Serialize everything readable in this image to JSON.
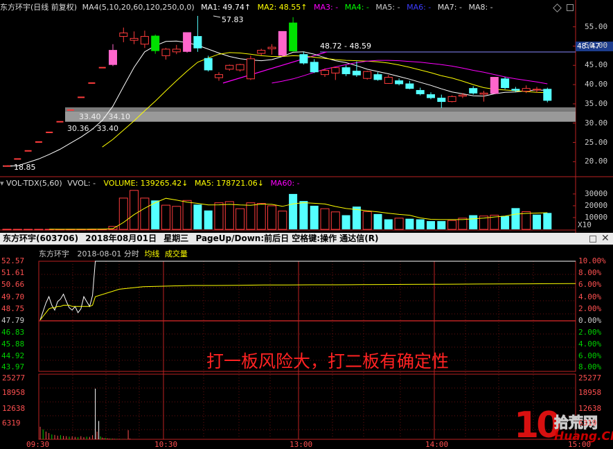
{
  "kline_header": {
    "stock": "东方环宇(日线 前复权)",
    "ma_setting": "MA4(5,10,20,60,120,250,0,0)",
    "ma1": "MA1: 49.74↑",
    "ma2": "MA2: 48.55↑",
    "ma3": "MA3: -",
    "ma4": "MA4: -",
    "ma5": "MA5: -",
    "ma6": "MA6: -",
    "ma7": "MA7: -",
    "ma8": "MA8: -"
  },
  "kline_annotations": {
    "high_label": "57.83",
    "low_label": "18.85",
    "mid_label": "48.72 - 48.59",
    "band1_label": "33.40 - 34.10",
    "band2_label": "30.36 - 33.40",
    "last_price": "48.47"
  },
  "kline_yaxis": [
    "55.00",
    "50.00",
    "45.00",
    "40.00",
    "35.00",
    "30.00",
    "25.00",
    "20.00"
  ],
  "vol_header": {
    "name": "VOL-TDX(5,60)",
    "vvol": "VVOL: -",
    "volume": "VOLUME: 139265.42↓",
    "ma5": "MA5: 178721.06↓",
    "ma60": "MA60: -"
  },
  "vol_yaxis": [
    "30000",
    "20000",
    "10000"
  ],
  "vol_unit": "X10",
  "intraday_bar": {
    "title": "东方环宇(603706)",
    "date": "2018年08月01日",
    "weekday": "星期三",
    "hint": "PageUp/Down:前后日 空格键:操作 通达信(R)"
  },
  "intraday_header": {
    "name": "东方环宇",
    "datetime": "2018-08-01 分时",
    "avg": "均线",
    "vol": "成交量"
  },
  "intraday_left_axis": [
    "52.57",
    "51.61",
    "50.66",
    "49.70",
    "48.75",
    "47.79",
    "46.83",
    "45.88",
    "44.92",
    "43.97"
  ],
  "intraday_right_axis": [
    "10.00%",
    "8.00%",
    "6.00%",
    "4.00%",
    "2.00%",
    "0.00%",
    "2.00%",
    "4.00%",
    "6.00%",
    "8.00%"
  ],
  "intraday_vol_axis": [
    "25277",
    "18958",
    "12638",
    "6319"
  ],
  "time_axis": [
    "09:30",
    "10:30",
    "13:00",
    "14:00",
    "15:00"
  ],
  "caption": "打一板风险大，打二板有确定性",
  "watermark": {
    "logo": "10",
    "cn": "拾荒网",
    "en": "Huang.CN"
  },
  "colors": {
    "up": "#ff3c3c",
    "down": "#54ffff",
    "limit_up": "#ff66cc",
    "green_bar": "#00e000",
    "ma1": "#ffffff",
    "ma2": "#ffff00",
    "ma3": "#ff00ff",
    "ma4": "#00ff00",
    "ma6": "#3333ff"
  },
  "chart_data": [
    {
      "type": "candlestick",
      "title": "东方环宇(日线 前复权)",
      "yaxis_ticks": [
        55,
        50,
        45,
        40,
        35,
        30,
        25,
        20
      ],
      "ylim": [
        17,
        58
      ],
      "candles": [
        {
          "o": 18.85,
          "h": 18.85,
          "c": 18.85,
          "l": 18.85,
          "t": "flat"
        },
        {
          "o": 20.7,
          "h": 20.7,
          "c": 20.7,
          "l": 20.7,
          "t": "flat"
        },
        {
          "o": 22.8,
          "h": 22.8,
          "c": 22.8,
          "l": 22.8,
          "t": "flat"
        },
        {
          "o": 25.1,
          "h": 25.1,
          "c": 25.1,
          "l": 25.1,
          "t": "flat"
        },
        {
          "o": 27.6,
          "h": 27.6,
          "c": 27.6,
          "l": 27.6,
          "t": "flat"
        },
        {
          "o": 30.36,
          "h": 30.36,
          "c": 30.36,
          "l": 30.36,
          "t": "flat"
        },
        {
          "o": 33.4,
          "h": 33.4,
          "c": 33.4,
          "l": 33.4,
          "t": "flat"
        },
        {
          "o": 36.7,
          "h": 36.7,
          "c": 36.7,
          "l": 36.7,
          "t": "flat"
        },
        {
          "o": 40.4,
          "h": 40.4,
          "c": 40.4,
          "l": 40.4,
          "t": "flat"
        },
        {
          "o": 44.4,
          "h": 44.4,
          "c": 44.4,
          "l": 44.4,
          "t": "flat"
        },
        {
          "o": 45.2,
          "h": 50.5,
          "c": 48.9,
          "l": 44.8,
          "t": "limit"
        },
        {
          "o": 52.5,
          "h": 54.8,
          "c": 53.4,
          "l": 51.0,
          "t": "up"
        },
        {
          "o": 52.0,
          "h": 53.8,
          "c": 51.5,
          "l": 50.5,
          "t": "up"
        },
        {
          "o": 50.5,
          "h": 54.0,
          "c": 52.5,
          "l": 49.5,
          "t": "up"
        },
        {
          "o": 52.6,
          "h": 53.0,
          "c": 48.8,
          "l": 48.0,
          "t": "green"
        },
        {
          "o": 47.5,
          "h": 49.5,
          "c": 49.2,
          "l": 46.5,
          "t": "up"
        },
        {
          "o": 48.5,
          "h": 50.3,
          "c": 49.2,
          "l": 47.9,
          "t": "up"
        },
        {
          "o": 48.6,
          "h": 53.5,
          "c": 53.5,
          "l": 48.3,
          "t": "limit"
        },
        {
          "o": 52.5,
          "h": 57.83,
          "c": 49.5,
          "l": 48.5,
          "t": "down"
        },
        {
          "o": 46.8,
          "h": 47.5,
          "c": 43.8,
          "l": 43.4,
          "t": "down"
        },
        {
          "o": 41.8,
          "h": 43.2,
          "c": 42.6,
          "l": 41.0,
          "t": "up"
        },
        {
          "o": 44.0,
          "h": 45.2,
          "c": 45.0,
          "l": 43.6,
          "t": "up"
        },
        {
          "o": 43.8,
          "h": 45.4,
          "c": 45.2,
          "l": 43.4,
          "t": "up"
        },
        {
          "o": 41.5,
          "h": 47.5,
          "c": 46.7,
          "l": 41.2,
          "t": "up"
        },
        {
          "o": 48.1,
          "h": 49.3,
          "c": 48.9,
          "l": 47.6,
          "t": "up"
        },
        {
          "o": 49.7,
          "h": 50.5,
          "c": 49.3,
          "l": 47.8,
          "t": "up"
        },
        {
          "o": 47.6,
          "h": 53.8,
          "c": 53.8,
          "l": 47.2,
          "t": "limit"
        },
        {
          "o": 56.0,
          "h": 57.5,
          "c": 48.72,
          "l": 48.59,
          "t": "green"
        },
        {
          "o": 47.8,
          "h": 48.5,
          "c": 45.6,
          "l": 45.2,
          "t": "down"
        },
        {
          "o": 45.8,
          "h": 46.6,
          "c": 43.3,
          "l": 43.0,
          "t": "down"
        },
        {
          "o": 42.6,
          "h": 44.2,
          "c": 43.7,
          "l": 42.0,
          "t": "up"
        },
        {
          "o": 43.0,
          "h": 44.6,
          "c": 44.4,
          "l": 41.2,
          "t": "up"
        },
        {
          "o": 44.4,
          "h": 45.0,
          "c": 42.8,
          "l": 42.2,
          "t": "down"
        },
        {
          "o": 42.5,
          "h": 46.0,
          "c": 43.5,
          "l": 42.0,
          "t": "down"
        },
        {
          "o": 43.4,
          "h": 43.6,
          "c": 41.6,
          "l": 41.3,
          "t": "up"
        },
        {
          "o": 42.6,
          "h": 43.2,
          "c": 41.3,
          "l": 41.0,
          "t": "down"
        },
        {
          "o": 41.9,
          "h": 42.5,
          "c": 40.3,
          "l": 40.2,
          "t": "up"
        },
        {
          "o": 41.0,
          "h": 41.6,
          "c": 40.2,
          "l": 39.8,
          "t": "down"
        },
        {
          "o": 40.2,
          "h": 41.0,
          "c": 39.0,
          "l": 38.8,
          "t": "down"
        },
        {
          "o": 38.5,
          "h": 39.2,
          "c": 37.6,
          "l": 37.2,
          "t": "down"
        },
        {
          "o": 37.4,
          "h": 38.0,
          "c": 36.6,
          "l": 36.2,
          "t": "down"
        },
        {
          "o": 36.5,
          "h": 37.4,
          "c": 35.6,
          "l": 33.9,
          "t": "down"
        },
        {
          "o": 35.6,
          "h": 37.2,
          "c": 36.9,
          "l": 35.4,
          "t": "up"
        },
        {
          "o": 37.0,
          "h": 37.8,
          "c": 37.3,
          "l": 36.5,
          "t": "up"
        },
        {
          "o": 39.0,
          "h": 39.6,
          "c": 37.8,
          "l": 37.4,
          "t": "down"
        },
        {
          "o": 37.8,
          "h": 38.4,
          "c": 37.5,
          "l": 35.6,
          "t": "up"
        },
        {
          "o": 37.7,
          "h": 41.9,
          "c": 41.9,
          "l": 37.6,
          "t": "limit"
        },
        {
          "o": 41.5,
          "h": 42.0,
          "c": 39.2,
          "l": 38.8,
          "t": "down"
        },
        {
          "o": 38.5,
          "h": 39.4,
          "c": 38.8,
          "l": 38.0,
          "t": "down"
        },
        {
          "o": 38.3,
          "h": 39.8,
          "c": 39.0,
          "l": 37.8,
          "t": "up"
        },
        {
          "o": 38.8,
          "h": 39.4,
          "c": 38.6,
          "l": 37.9,
          "t": "up"
        },
        {
          "o": 38.8,
          "h": 39.2,
          "c": 35.9,
          "l": 35.4,
          "t": "down"
        }
      ],
      "series": [
        {
          "name": "MA1",
          "values": [
            18.9,
            18.9,
            19.8,
            20.7,
            21.9,
            23.2,
            24.8,
            26.4,
            28.3,
            30.7,
            34.4,
            39.5,
            44.5,
            48.5,
            50.1,
            51.2,
            51.3,
            50.9,
            50.2,
            49.2,
            48.2,
            47.3,
            46.7,
            46.4,
            46.2,
            46.5,
            47.3,
            48.4,
            48.5,
            47.9,
            47.0,
            46.2,
            45.7,
            44.9,
            44.0,
            43.4,
            42.8,
            42.1,
            41.4,
            40.6,
            39.8,
            38.9,
            38.1,
            37.6,
            37.1,
            37.0,
            37.6,
            38.0,
            38.1,
            38.4,
            38.6,
            38.5
          ]
        },
        {
          "name": "MA2",
          "values": [
            null,
            null,
            null,
            null,
            null,
            null,
            null,
            null,
            null,
            23.8,
            25.8,
            28.2,
            30.6,
            33.2,
            35.7,
            38.4,
            41.0,
            43.5,
            45.8,
            46.9,
            47.9,
            48.3,
            48.2,
            47.9,
            47.5,
            47.3,
            47.3,
            47.5,
            47.4,
            47.1,
            46.8,
            46.5,
            46.3,
            46.2,
            46.1,
            45.9,
            45.6,
            45.1,
            44.5,
            43.8,
            43.1,
            42.3,
            41.7,
            40.9,
            40.0,
            39.2,
            38.8,
            38.6,
            38.4,
            38.2,
            38.0,
            37.9
          ]
        },
        {
          "name": "MA3",
          "values": [
            null,
            null,
            null,
            null,
            null,
            null,
            null,
            null,
            null,
            null,
            null,
            null,
            null,
            null,
            null,
            null,
            null,
            null,
            null,
            null,
            null,
            null,
            null,
            null,
            null,
            40.4,
            40.9,
            41.5,
            42.3,
            43.2,
            44.0,
            44.6,
            45.2,
            45.7,
            46.1,
            46.3,
            46.3,
            46.2,
            46.0,
            45.8,
            45.5,
            45.2,
            44.8,
            44.3,
            43.7,
            43.2,
            42.6,
            42.0,
            41.5,
            41.1,
            40.7,
            40.2
          ]
        }
      ]
    },
    {
      "type": "bar",
      "title": "VOL-TDX(5,60)",
      "unit": "X10",
      "yaxis_ticks": [
        30000,
        20000,
        10000
      ],
      "ylim": [
        0,
        37000
      ],
      "values": [
        120,
        60,
        60,
        60,
        60,
        60,
        100,
        120,
        160,
        200,
        2500,
        26500,
        33000,
        26500,
        24500,
        20500,
        19500,
        24500,
        21000,
        16000,
        22500,
        23500,
        17500,
        22500,
        22000,
        20000,
        15500,
        30000,
        24000,
        20000,
        17500,
        14800,
        12000,
        19300,
        15000,
        13000,
        8500,
        9500,
        9000,
        8500,
        7000,
        7000,
        7500,
        9500,
        12000,
        11300,
        12000,
        11300,
        18000,
        15000,
        12500,
        13900
      ],
      "colors": [
        "r",
        "r",
        "r",
        "r",
        "r",
        "r",
        "r",
        "r",
        "r",
        "r",
        "r",
        "r",
        "r",
        "r",
        "c",
        "r",
        "r",
        "r",
        "c",
        "c",
        "r",
        "r",
        "r",
        "r",
        "r",
        "r",
        "r",
        "c",
        "c",
        "c",
        "r",
        "r",
        "c",
        "c",
        "r",
        "c",
        "c",
        "r",
        "c",
        "c",
        "c",
        "c",
        "r",
        "r",
        "c",
        "r",
        "r",
        "c",
        "c",
        "r",
        "c",
        "c"
      ],
      "series": [
        {
          "name": "MA5",
          "values": [
            null,
            null,
            null,
            null,
            90,
            60,
            70,
            80,
            110,
            140,
            600,
            5900,
            12500,
            17900,
            22600,
            26300,
            24800,
            23100,
            22000,
            20700,
            20800,
            21200,
            20700,
            20400,
            21400,
            21200,
            19500,
            21600,
            22600,
            22100,
            21500,
            19400,
            17700,
            16800,
            15700,
            14800,
            13700,
            12700,
            12000,
            9700,
            8500,
            8300,
            8300,
            8300,
            8900,
            9600,
            10500,
            11200,
            12900,
            13500,
            13800,
            14100
          ]
        }
      ]
    },
    {
      "type": "line",
      "title": "东方环宇 2018-08-01 分时",
      "x": [
        "09:30",
        "10:30",
        "13:00",
        "14:00",
        "15:00"
      ],
      "y_ticks_left": [
        52.57,
        51.61,
        50.66,
        49.7,
        48.75,
        47.79,
        46.83,
        45.88,
        44.92,
        43.97
      ],
      "y_ticks_right": [
        "10.00%",
        "8.00%",
        "6.00%",
        "4.00%",
        "2.00%",
        "0.00%",
        "2.00%",
        "4.00%",
        "6.00%",
        "8.00%"
      ],
      "ylim": [
        43.5,
        52.6
      ],
      "series": [
        {
          "name": "price",
          "values": [
            47.79,
            48.5,
            49.2,
            49.7,
            49.0,
            48.6,
            49.3,
            49.5,
            49.9,
            49.3,
            48.8,
            48.6,
            48.9,
            48.4,
            48.7,
            49.7,
            49.3,
            48.9,
            49.8,
            52.57,
            52.57,
            52.57,
            52.57,
            52.57,
            52.57,
            52.57,
            52.57,
            52.57,
            52.57,
            52.57,
            52.57,
            52.57,
            52.57,
            52.57,
            52.57,
            52.57,
            52.57,
            52.57,
            52.57,
            52.57
          ]
        },
        {
          "name": "均线",
          "values": [
            47.79,
            48.1,
            48.4,
            48.7,
            48.8,
            48.8,
            48.9,
            48.9,
            49.0,
            49.0,
            49.0,
            48.9,
            48.9,
            48.9,
            48.9,
            48.9,
            48.9,
            48.9,
            49.0,
            49.7,
            50.3,
            50.5,
            50.55,
            50.6,
            50.6,
            50.62,
            50.64,
            50.65,
            50.66,
            50.66,
            50.67,
            50.68,
            50.69,
            50.7,
            50.71,
            50.72,
            50.73,
            50.74,
            50.75,
            50.76
          ]
        }
      ]
    },
    {
      "type": "bar",
      "title": "分时 成交量",
      "yaxis_ticks": [
        25277,
        18958,
        12638,
        6319
      ],
      "ylim": [
        0,
        25277
      ],
      "values": [
        5200,
        4100,
        3200,
        2600,
        2000,
        1800,
        1500,
        1700,
        1400,
        1300,
        1100,
        1200,
        1000,
        900,
        1300,
        900,
        1100,
        1000,
        1700,
        21000,
        3200,
        7600,
        1200,
        700,
        500,
        600,
        400,
        300,
        300,
        250,
        200,
        200,
        150,
        150,
        120,
        100,
        100,
        100,
        3800,
        300
      ]
    }
  ]
}
